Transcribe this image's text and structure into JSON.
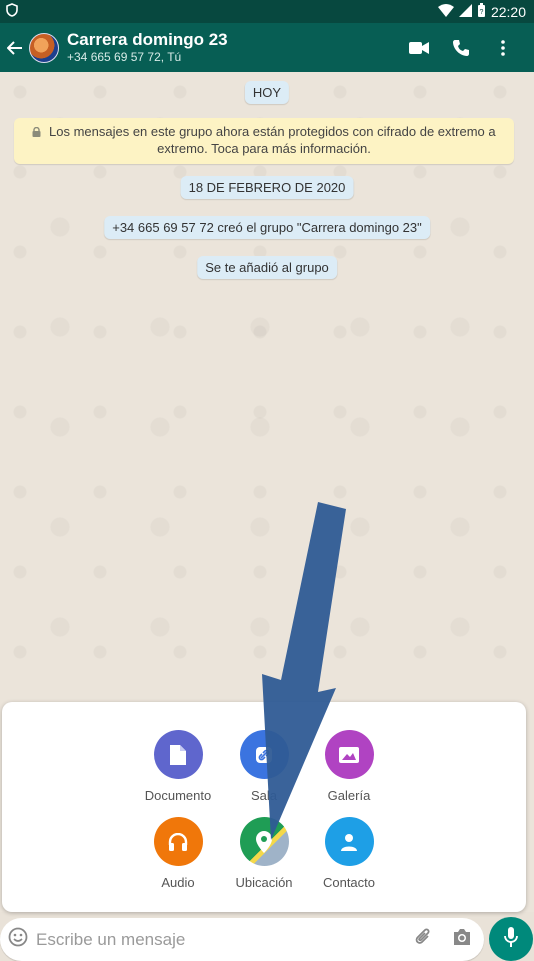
{
  "status": {
    "time": "22:20"
  },
  "header": {
    "title": "Carrera domingo 23",
    "subtitle": "+34 665 69 57 72, Tú",
    "icons": [
      "back-arrow-icon",
      "video-call-icon",
      "phone-icon",
      "more-options-icon"
    ]
  },
  "chat": {
    "date_today": "HOY",
    "encryption_notice": "Los mensajes en este grupo ahora están protegidos con cifrado de extremo a extremo. Toca para más información.",
    "date_old": "18 DE FEBRERO DE 2020",
    "created": "+34 665 69 57 72 creó el grupo \"Carrera domingo 23\"",
    "added": "Se te añadió al grupo"
  },
  "attach": {
    "documento": "Documento",
    "sala": "Sala",
    "galeria": "Galería",
    "audio": "Audio",
    "ubicacion": "Ubicación",
    "contacto": "Contacto"
  },
  "composer": {
    "placeholder": "Escribe un mensaje"
  },
  "colors": {
    "header": "#075e54",
    "documento": "#5f66cd",
    "sala": "#3b74e0",
    "galeria": "#b043c2",
    "audio": "#f0770a",
    "ubicacion": "#1f9d55",
    "contacto": "#1e9fe6",
    "mic": "#00897b",
    "annotation_arrow": "#2f5b95"
  }
}
